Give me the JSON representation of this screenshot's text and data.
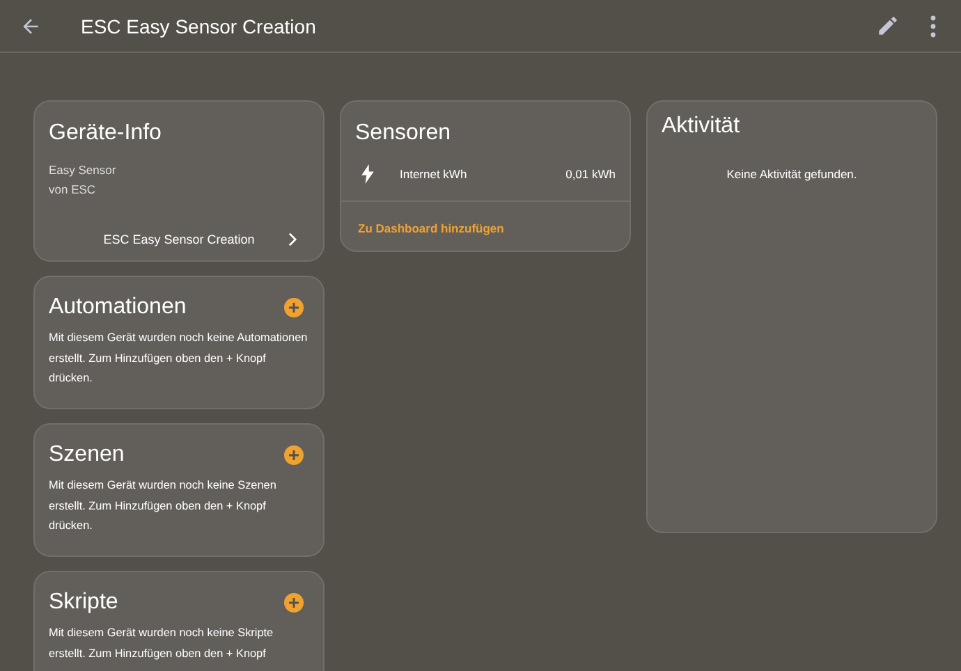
{
  "header": {
    "title": "ESC Easy Sensor Creation"
  },
  "device_info": {
    "title": "Geräte-Info",
    "model": "Easy Sensor",
    "manufacturer": "von ESC",
    "link": "ESC Easy Sensor Creation"
  },
  "sections": [
    {
      "title": "Automationen",
      "text": "Mit diesem Gerät wurden noch keine Automationen erstellt. Zum Hinzufügen oben den + Knopf drücken."
    },
    {
      "title": "Szenen",
      "text": "Mit diesem Gerät wurden noch keine Szenen erstellt. Zum Hinzufügen oben den + Knopf drücken."
    },
    {
      "title": "Skripte",
      "text": "Mit diesem Gerät wurden noch keine Skripte erstellt. Zum Hinzufügen oben den + Knopf"
    }
  ],
  "sensors": {
    "title": "Sensoren",
    "rows": [
      {
        "name": "Internet kWh",
        "value": "0,01 kWh"
      }
    ],
    "action": "Zu Dashboard hinzufügen"
  },
  "activity": {
    "title": "Aktivität",
    "empty": "Keine Aktivität gefunden."
  }
}
